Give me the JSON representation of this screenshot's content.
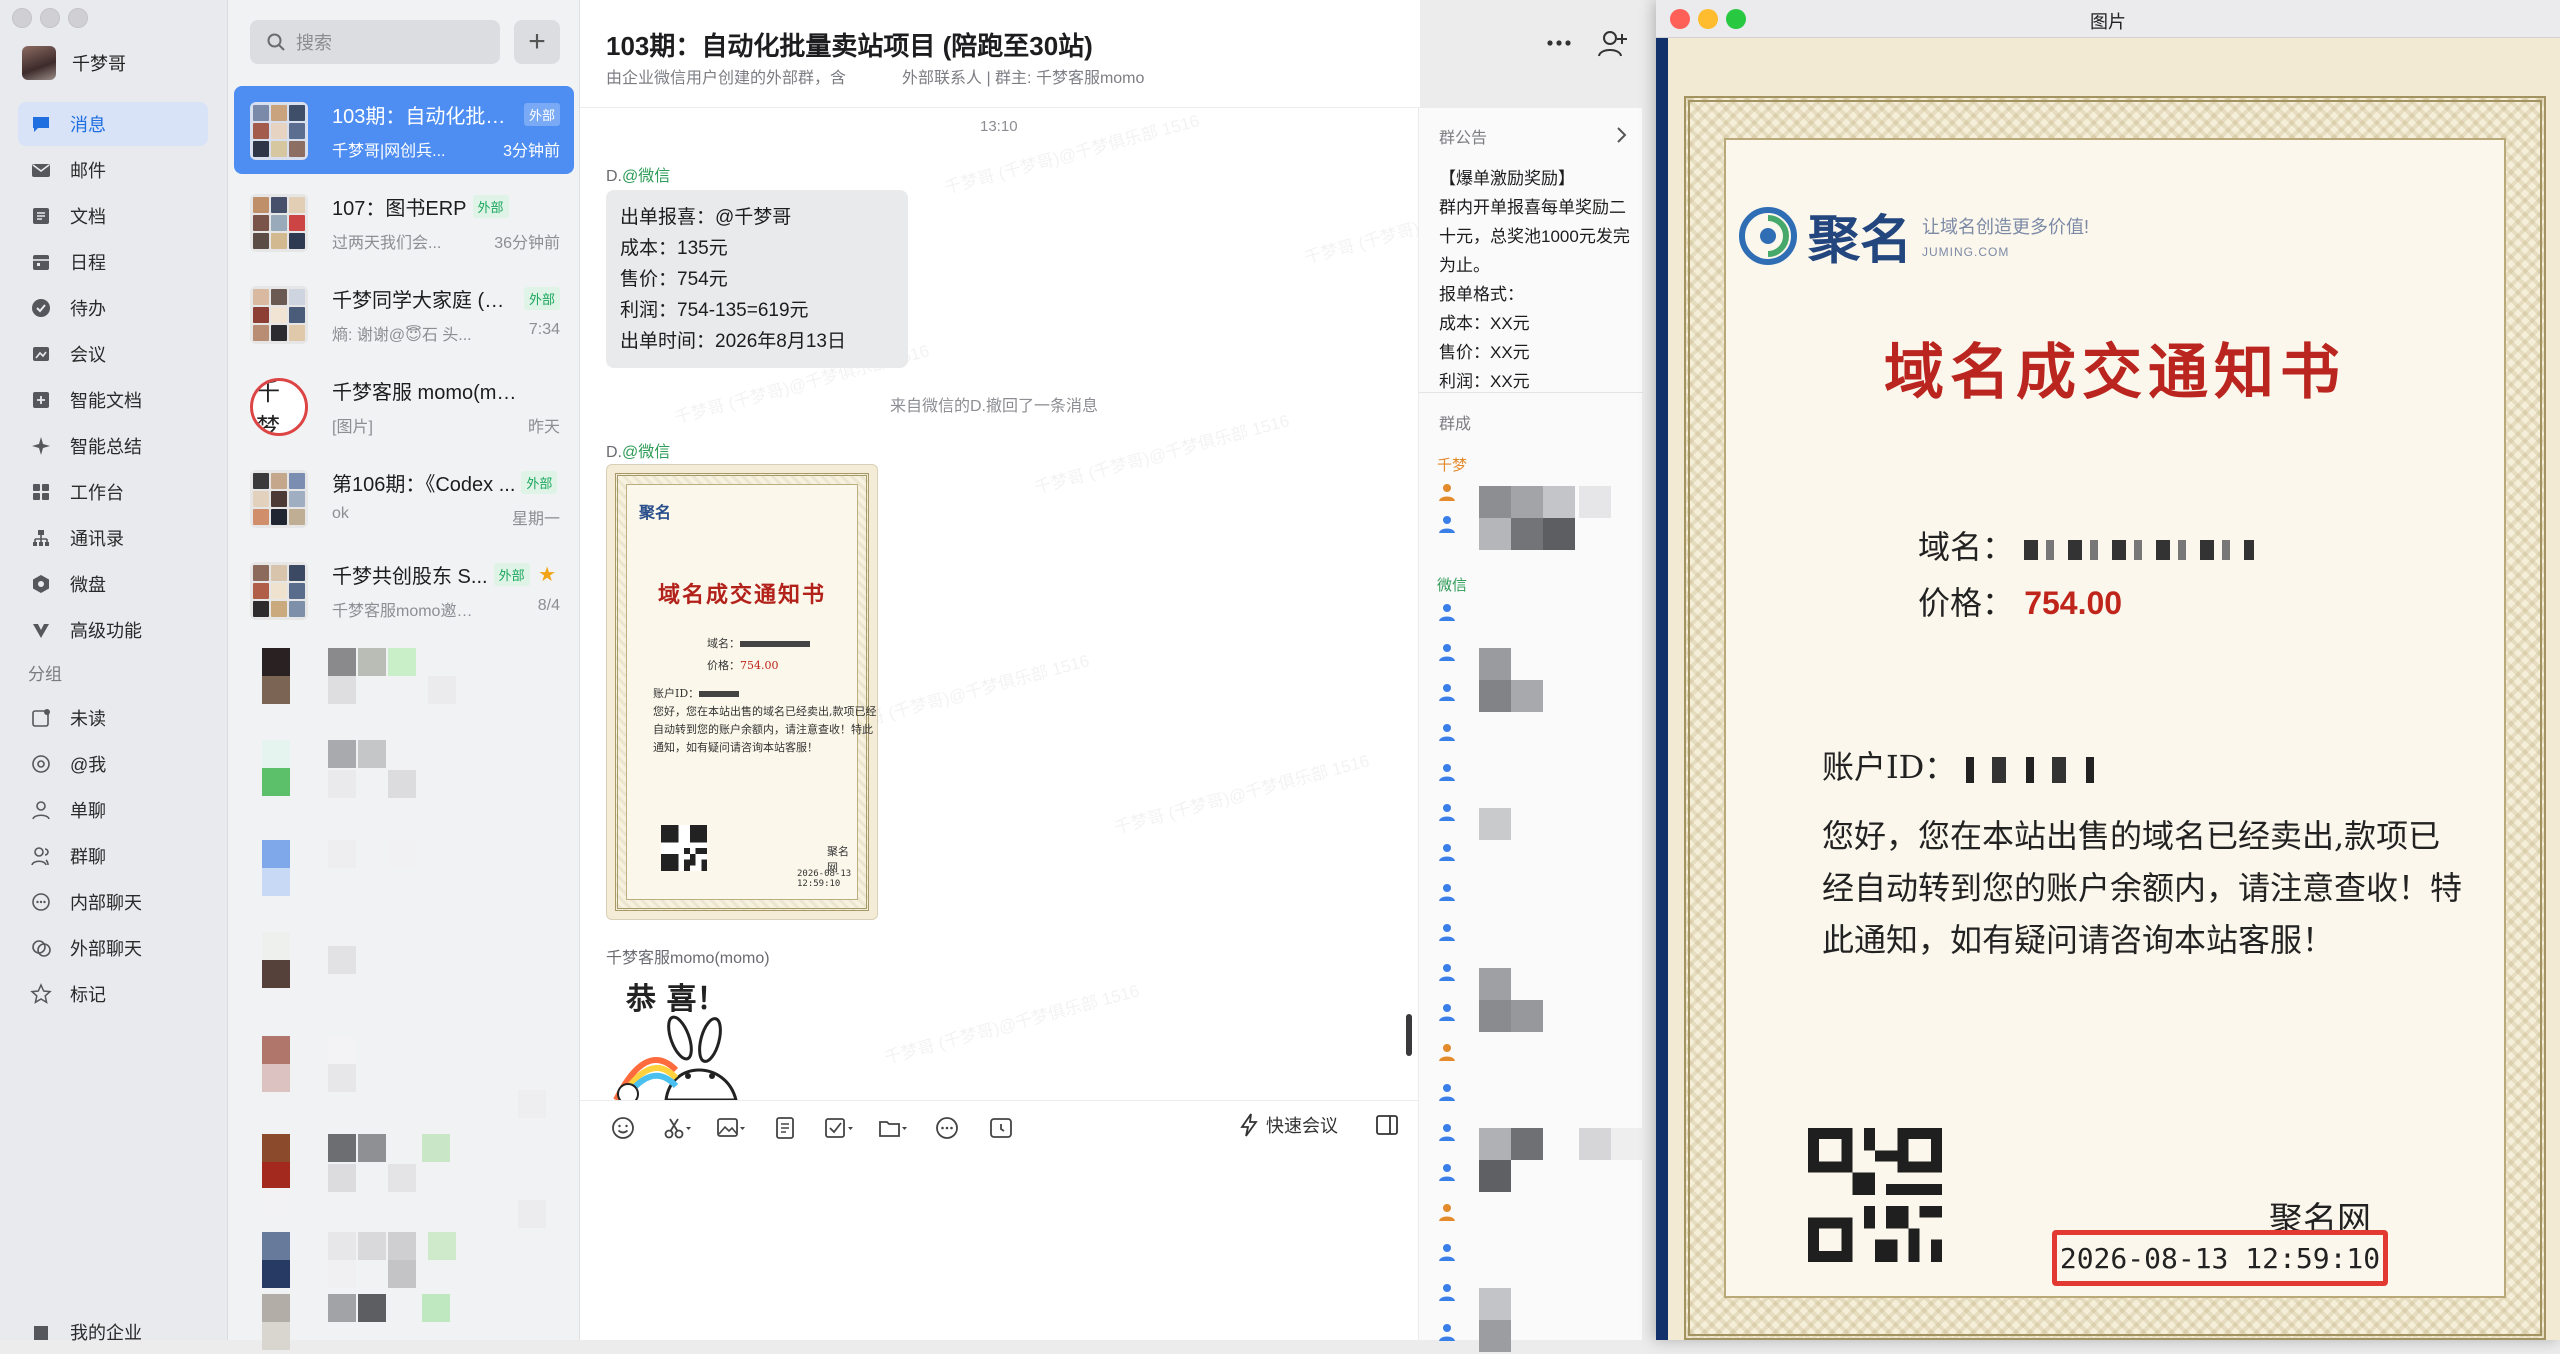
{
  "user": {
    "name": "千梦哥"
  },
  "nav": {
    "items": [
      {
        "label": "消息",
        "icon": "message-icon"
      },
      {
        "label": "邮件",
        "icon": "mail-icon"
      },
      {
        "label": "文档",
        "icon": "document-icon"
      },
      {
        "label": "日程",
        "icon": "calendar-icon"
      },
      {
        "label": "待办",
        "icon": "todo-icon"
      },
      {
        "label": "会议",
        "icon": "meeting-icon"
      },
      {
        "label": "智能文档",
        "icon": "smart-doc-icon"
      },
      {
        "label": "智能总结",
        "icon": "sparkle-icon"
      },
      {
        "label": "工作台",
        "icon": "workbench-icon"
      },
      {
        "label": "通讯录",
        "icon": "contacts-icon"
      },
      {
        "label": "微盘",
        "icon": "drive-icon"
      },
      {
        "label": "高级功能",
        "icon": "advanced-icon"
      }
    ],
    "group_title": "分组",
    "groups": [
      {
        "label": "未读",
        "icon": "unread-icon"
      },
      {
        "label": "@我",
        "icon": "at-icon"
      },
      {
        "label": "单聊",
        "icon": "single-chat-icon"
      },
      {
        "label": "群聊",
        "icon": "group-chat-icon"
      },
      {
        "label": "内部聊天",
        "icon": "internal-chat-icon"
      },
      {
        "label": "外部聊天",
        "icon": "external-chat-icon"
      },
      {
        "label": "标记",
        "icon": "star-icon"
      }
    ],
    "footer": "我的企业"
  },
  "search": {
    "placeholder": "搜索"
  },
  "conversations": [
    {
      "name": "103期：自动化批量...",
      "tag": "外部",
      "preview": "千梦哥|网创兵...",
      "time": "3分钟前",
      "selected": true
    },
    {
      "name": "107：图书ERP",
      "tag": "外部",
      "preview": "过两天我们会...",
      "time": "36分钟前"
    },
    {
      "name": "千梦同学大家庭 (全...",
      "tag": "外部",
      "preview": "熵: 谢谢@😇石 头...",
      "time": "7:34"
    },
    {
      "name": "千梦客服 momo(momo)",
      "tag": "",
      "preview": "[图片]",
      "time": "昨天"
    },
    {
      "name": "第106期：《Codex ...",
      "tag": "外部",
      "preview": "ok",
      "time": "星期一"
    },
    {
      "name": "千梦共创股东 S...",
      "tag": "外部",
      "preview": "千梦客服momo邀请...",
      "time": "8/4",
      "starred": true
    }
  ],
  "chat": {
    "title": "103期：自动化批量卖站项目 (陪跑至30站)",
    "subtitle": "由企业微信用户创建的外部群，含",
    "subtitle2": "外部联系人 | 群主: 千梦客服momo",
    "time": "13:10",
    "msg1_sender": "D.",
    "msg1_via": "@微信",
    "msg1_lines": [
      "出单报喜：@千梦哥",
      "成本：135元",
      "售价：754元",
      "利润：754-135=619元",
      "出单时间：2026年8月13日"
    ],
    "recall": "来自微信的D.撤回了一条消息",
    "msg2_sender": "D.",
    "msg2_via": "@微信",
    "msg3_sender": "千梦客服momo(momo)",
    "sticker_text": "恭 喜！",
    "quick_meeting": "快速会议",
    "watermark": "千梦哥 (千梦哥)@千梦俱乐部 1516"
  },
  "panel": {
    "announcement_title": "群公告",
    "announcement_body": "【爆单激励奖励】\n群内开单报喜每单奖励二十元，总奖池1000元发完为止。\n报单格式：\n成本：XX元\n售价：XX元\n利润：XX元",
    "members_title": "群成",
    "sec1": "千梦",
    "sec2": "微信"
  },
  "viewer": {
    "title": "图片"
  },
  "certificate": {
    "brand": "聚名",
    "slogan": "让域名创造更多价值!",
    "url": "JUMING.COM",
    "title": "域名成交通知书",
    "domain_label": "域名：",
    "domain_value": "—",
    "price_label": "价格：",
    "price_value": "754.00",
    "account_label": "账户ID：",
    "account_value": "—",
    "body": "您好，您在本站出售的域名已经卖出,款项已经自动转到您的账户余额内，请注意查收！特此通知，如有疑问请咨询本站客服！",
    "signature": "聚名网",
    "date": "2026-08-13 12:59:10"
  },
  "colors": {
    "accent": "#4e8ef2",
    "link_green": "#2f9c57",
    "cert_red": "#ba261f",
    "highlight_box": "#e23a33"
  }
}
